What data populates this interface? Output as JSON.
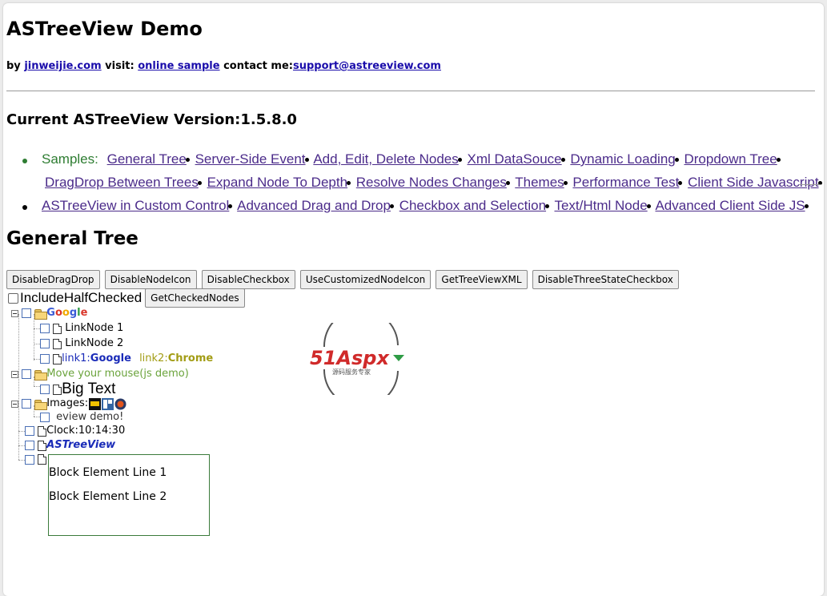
{
  "header": {
    "title": "ASTreeView Demo",
    "by_label": "by ",
    "by_link": "jinweijie.com",
    "visit_label": " visit: ",
    "visit_link": "online sample",
    "contact_label": " contact me:",
    "contact_link": "support@astreeview.com"
  },
  "version": "Current ASTreeView Version:1.5.8.0",
  "nav": {
    "samples_label": "Samples:",
    "lines": [
      [
        "General Tree",
        "Server-Side Event",
        "Add, Edit, Delete Nodes",
        "Xml DataSouce",
        "Dynamic Loading",
        "Dropdown Tree"
      ],
      [
        "DragDrop Between Trees",
        "Expand Node To Depth",
        "Resolve Nodes Changes",
        "Themes",
        "Performance Test",
        "Client Side Javascript"
      ],
      [
        "ASTreeView in Custom Control",
        "Advanced Drag and Drop",
        "Checkbox and Selection",
        "Text/Html Node",
        "Advanced Client Side JS"
      ]
    ]
  },
  "section_title": "General Tree",
  "buttons": [
    "DisableDragDrop",
    "DisableNodeIcon",
    "DisableCheckbox",
    "UseCustomizedNodeIcon",
    "GetTreeViewXML",
    "DisableThreeStateCheckbox"
  ],
  "include_half_checked_label": "IncludeHalfChecked",
  "get_checked_button": "GetCheckedNodes",
  "tree": {
    "google_letters": [
      "G",
      "o",
      "o",
      "g",
      "l",
      "e"
    ],
    "link_node_1": "LinkNode 1",
    "link_node_2": "LinkNode 2",
    "link1_label": "link1:",
    "link1_value": "Google",
    "link2_label": "link2:",
    "link2_value": "Chrome",
    "move_mouse": "Move your mouse(js demo)",
    "big_text": "Big Text",
    "images_label": "Images:",
    "preview": "eview demo!",
    "clock": "Clock:10:14:30",
    "astreeview": "ASTreeView",
    "block_line_1": "Block Element Line 1",
    "block_line_2": "Block Element Line 2"
  },
  "watermark": {
    "brand": "51Aspx",
    "sub": "源码服务专家"
  },
  "colors": {
    "link": "#1a0dab",
    "nav_link": "#4b2b8a",
    "samples_green": "#2e7d32",
    "block_border": "#3a7a3a"
  }
}
